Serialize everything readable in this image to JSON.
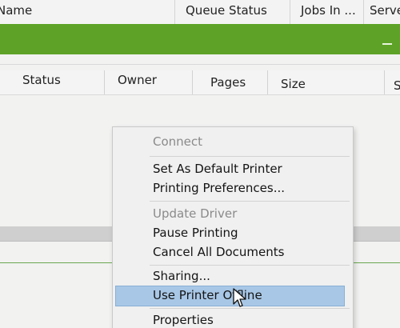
{
  "printer_list": {
    "columns": [
      "Name",
      "Queue Status",
      "Jobs In ...",
      "Serve"
    ]
  },
  "queue": {
    "columns": [
      "Status",
      "Owner",
      "Pages",
      "Size",
      "S"
    ]
  },
  "context_menu": {
    "items": [
      {
        "label": "Connect",
        "enabled": false
      },
      {
        "label": "Set As Default Printer",
        "enabled": true
      },
      {
        "label": "Printing Preferences...",
        "enabled": true
      },
      {
        "label": "Update Driver",
        "enabled": false
      },
      {
        "label": "Pause Printing",
        "enabled": true
      },
      {
        "label": "Cancel All Documents",
        "enabled": true
      },
      {
        "label": "Sharing...",
        "enabled": true
      },
      {
        "label": "Use Printer Offline",
        "enabled": true,
        "highlighted": true
      },
      {
        "label": "Properties",
        "enabled": true
      }
    ]
  },
  "colors": {
    "selected_row": "#5ea327",
    "menu_highlight": "#a8c7e6"
  },
  "icons": {
    "cursor": "pointer-cursor-icon"
  }
}
